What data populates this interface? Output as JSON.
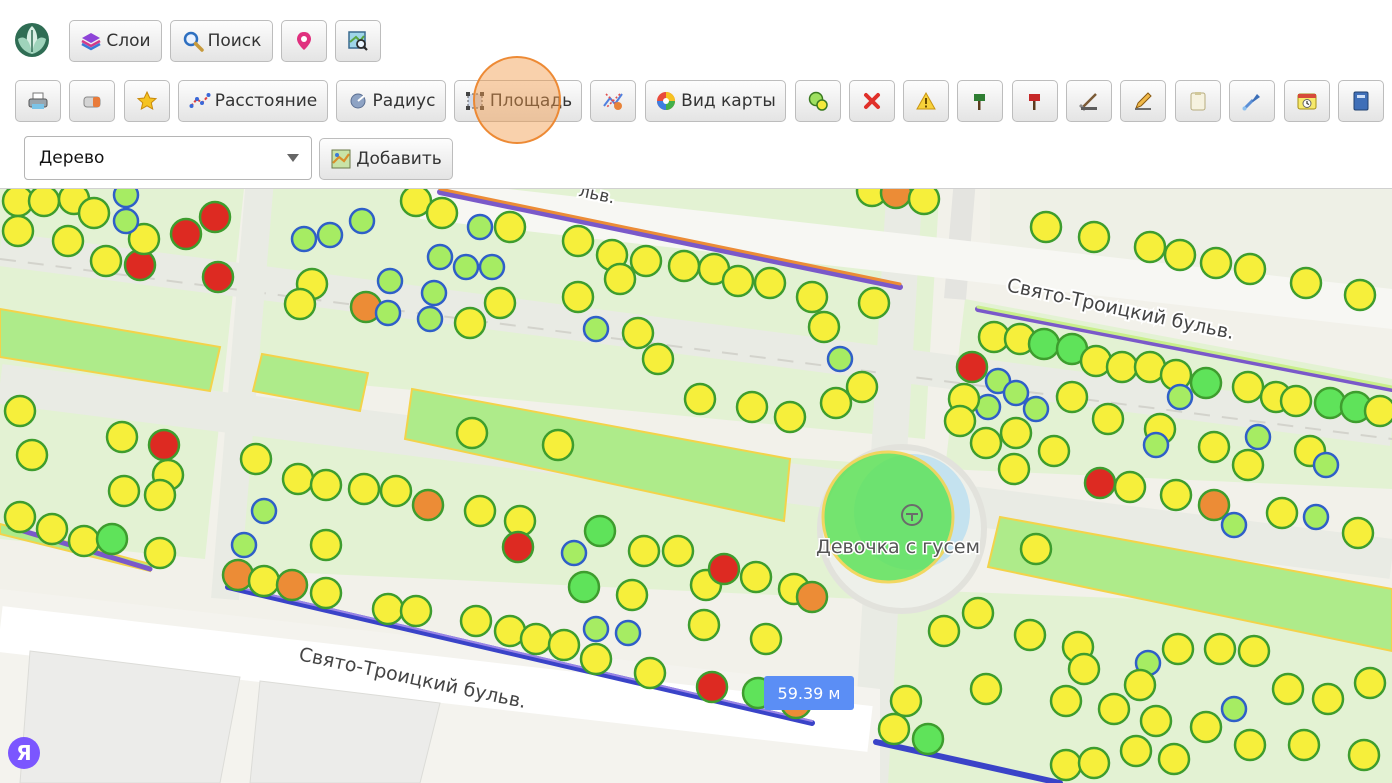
{
  "toolbar_top": {
    "layers_label": "Слои",
    "search_label": "Поиск"
  },
  "toolbar_tools": {
    "distance_label": "Расстояние",
    "radius_label": "Радиус",
    "area_label": "Площадь",
    "map_view_label": "Вид карты"
  },
  "add_bar": {
    "object_type_value": "Дерево",
    "add_label": "Добавить"
  },
  "map": {
    "street_label_1": "Свято-Троицкий бульв.",
    "street_label_2": "Свято-Троицкий бульв.",
    "street_label_partial": "льв.",
    "poi_label": "Девочка с гусем",
    "distance_tooltip": "59.39 м",
    "provider_badge": "Я"
  },
  "colors": {
    "tree_yellow": "#f6ef3b",
    "tree_green": "#5fe35a",
    "tree_red": "#dd2a22",
    "tree_orange": "#ec8c36",
    "tree_border": "#3e9d2e",
    "selected_border": "#2f5fc8",
    "park_green": "#e2f3d2",
    "lawn_green": "#aeeb8a",
    "path_gray": "#eef0ea"
  }
}
